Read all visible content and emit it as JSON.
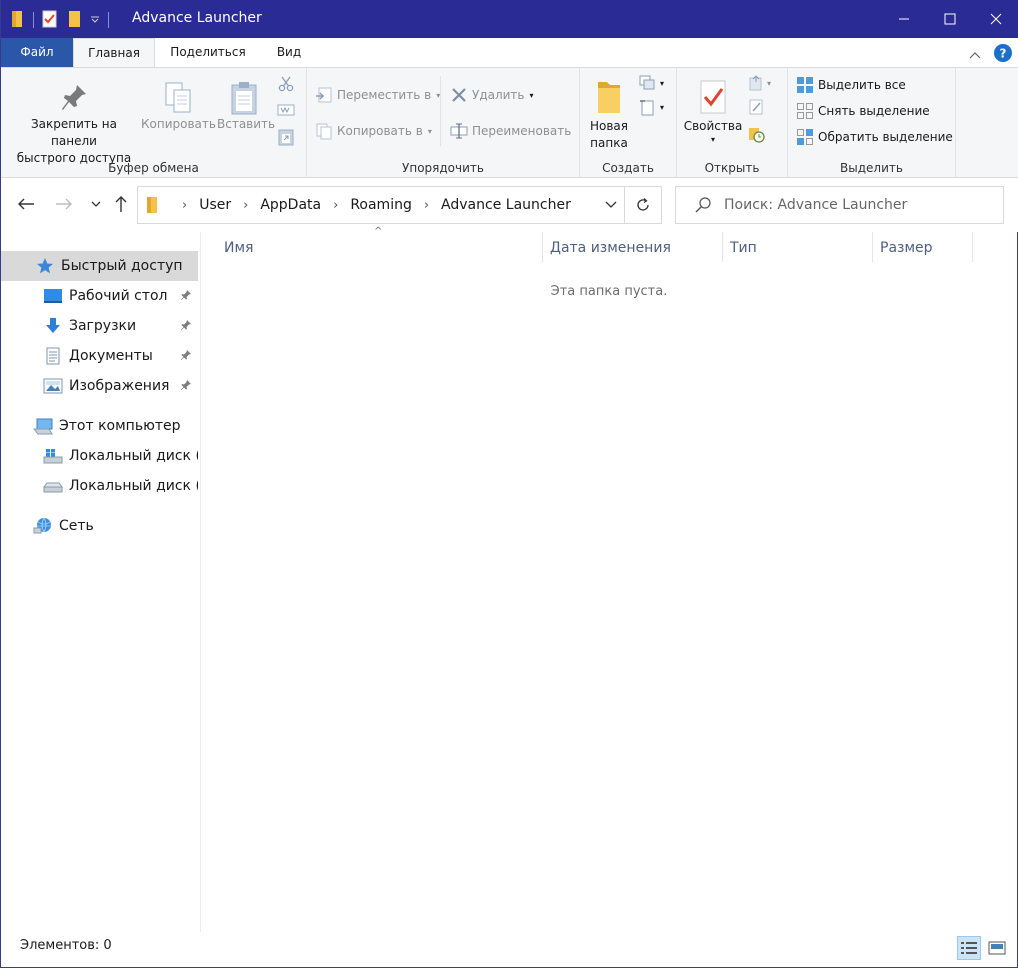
{
  "window": {
    "title": "Advance Launcher"
  },
  "colors": {
    "titlebar": "#2b2b96",
    "file_tab": "#2b57a8",
    "folder": "#f3c24a",
    "accent_blue": "#1a6fc9"
  },
  "tabs": {
    "file": "Файл",
    "home": "Главная",
    "share": "Поделиться",
    "view": "Вид"
  },
  "ribbon": {
    "clipboard": {
      "pin_label_line1": "Закрепить на панели",
      "pin_label_line2": "быстрого доступа",
      "copy_label": "Копировать",
      "paste_label": "Вставить",
      "group_label": "Буфер обмена"
    },
    "organize": {
      "move_to": "Переместить в",
      "copy_to": "Копировать в",
      "delete": "Удалить",
      "rename": "Переименовать",
      "group_label": "Упорядочить"
    },
    "new": {
      "new_folder_line1": "Новая",
      "new_folder_line2": "папка",
      "group_label": "Создать"
    },
    "open": {
      "properties": "Свойства",
      "group_label": "Открыть"
    },
    "select": {
      "select_all": "Выделить все",
      "select_none": "Снять выделение",
      "invert_selection": "Обратить выделение",
      "group_label": "Выделить"
    }
  },
  "address": {
    "crumbs": [
      "User",
      "AppData",
      "Roaming",
      "Advance Launcher"
    ]
  },
  "search": {
    "placeholder": "Поиск: Advance Launcher"
  },
  "navpane": {
    "quick_access": "Быстрый доступ",
    "desktop": "Рабочий стол",
    "downloads": "Загрузки",
    "documents": "Документы",
    "pictures": "Изображения",
    "this_pc": "Этот компьютер",
    "disk_c": "Локальный диск (C",
    "disk_d": "Локальный диск (D",
    "network": "Сеть"
  },
  "columns": {
    "name": "Имя",
    "date": "Дата изменения",
    "type": "Тип",
    "size": "Размер"
  },
  "content": {
    "empty_message": "Эта папка пуста."
  },
  "status": {
    "items": "Элементов: 0"
  }
}
